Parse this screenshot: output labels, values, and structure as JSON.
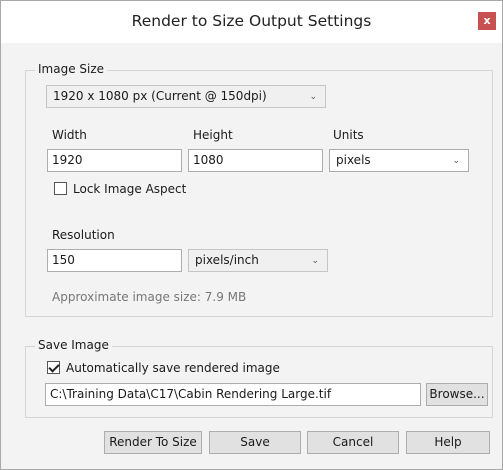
{
  "window": {
    "title": "Render to Size Output Settings",
    "close_glyph": "x"
  },
  "image_size": {
    "group_label": "Image Size",
    "preset_value": "1920 x 1080 px (Current @ 150dpi)",
    "width_label": "Width",
    "width_value": "1920",
    "height_label": "Height",
    "height_value": "1080",
    "units_label": "Units",
    "units_value": "pixels",
    "lock_aspect_label": "Lock Image Aspect",
    "lock_aspect_checked": false,
    "resolution_label": "Resolution",
    "resolution_value": "150",
    "resolution_unit": "pixels/inch",
    "approx_size_text": "Approximate image size: 7.9 MB"
  },
  "save_image": {
    "group_label": "Save Image",
    "auto_save_label": "Automatically save rendered image",
    "auto_save_checked": true,
    "file_path": "C:\\Training Data\\C17\\Cabin Rendering Large.tif",
    "browse_label": "Browse..."
  },
  "buttons": {
    "render": "Render To Size",
    "save": "Save",
    "cancel": "Cancel",
    "help": "Help"
  },
  "icons": {
    "dropdown": "chevron-down-icon",
    "close": "close-icon",
    "check": "checkmark-icon"
  }
}
